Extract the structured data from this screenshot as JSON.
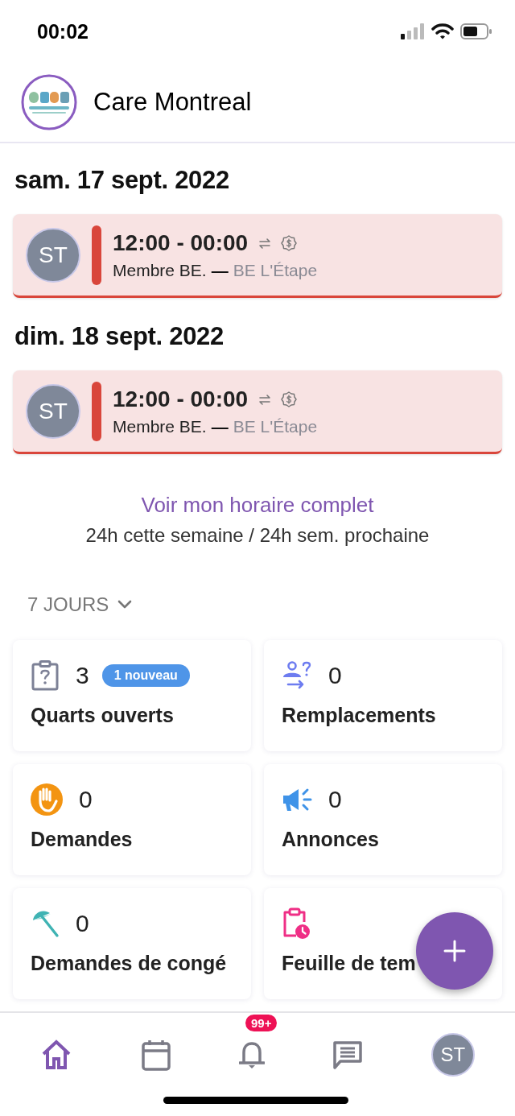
{
  "status_bar": {
    "time": "00:02"
  },
  "header": {
    "title": "Care Montreal"
  },
  "days": [
    {
      "date": "sam. 17 sept. 2022",
      "shifts": [
        {
          "initials": "ST",
          "time": "12:00 - 00:00",
          "role": "Membre BE.",
          "separator": "—",
          "location": "BE L'Étape",
          "color": "#d9463b"
        }
      ]
    },
    {
      "date": "dim. 18 sept. 2022",
      "shifts": [
        {
          "initials": "ST",
          "time": "12:00 - 00:00",
          "role": "Membre BE.",
          "separator": "—",
          "location": "BE L'Étape",
          "color": "#d9463b"
        }
      ]
    }
  ],
  "schedule_link": "Voir mon horaire complet",
  "hours_summary": "24h cette semaine / 24h sem. prochaine",
  "period_filter": {
    "label": "7 JOURS"
  },
  "stats": [
    {
      "kind": "open-shifts",
      "count": "3",
      "badge": "1 nouveau",
      "label": "Quarts ouverts"
    },
    {
      "kind": "replacements",
      "count": "0",
      "label": "Remplacements"
    },
    {
      "kind": "requests",
      "count": "0",
      "label": "Demandes"
    },
    {
      "kind": "announcements",
      "count": "0",
      "label": "Annonces"
    },
    {
      "kind": "leave",
      "count": "0",
      "label": "Demandes de congé"
    },
    {
      "kind": "timesheet",
      "label": "Feuille de tem"
    }
  ],
  "tab_bar": [
    {
      "kind": "home",
      "selected": true
    },
    {
      "kind": "calendar",
      "selected": false
    },
    {
      "kind": "notifications",
      "selected": false,
      "badge": "99+"
    },
    {
      "kind": "messages",
      "selected": false
    },
    {
      "kind": "profile",
      "selected": false,
      "initials": "ST"
    }
  ]
}
